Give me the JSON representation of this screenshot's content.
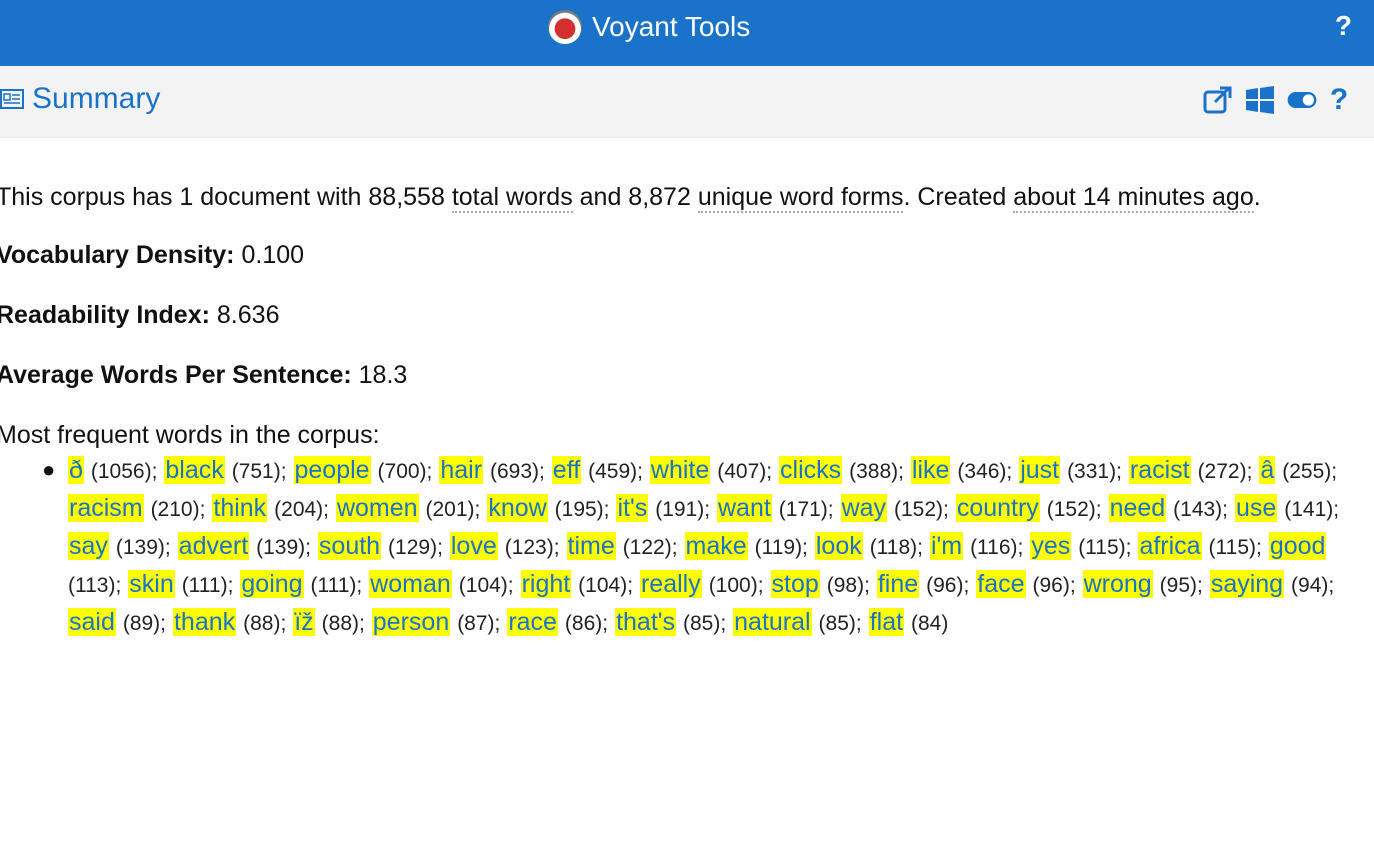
{
  "app": {
    "title": "Voyant Tools",
    "help_label": "?"
  },
  "panel": {
    "title": "Summary",
    "help_label": "?"
  },
  "summary": {
    "corpus_prefix": "This corpus has 1 document with 88,558 ",
    "total_words_link": "total words",
    "middle": " and 8,872 ",
    "unique_words_link": "unique word forms",
    "created_text": ". Created ",
    "created_link": "about 14 minutes ago",
    "period": "."
  },
  "metrics": {
    "vocab_label": "Vocabulary Density:",
    "vocab_value": "0.100",
    "readability_label": "Readability Index:",
    "readability_value": "8.636",
    "avg_label": "Average Words Per Sentence:",
    "avg_value": "18.3"
  },
  "frequent": {
    "heading": "Most frequent words in the corpus:",
    "terms": [
      {
        "term": "ð",
        "count": "(1056)"
      },
      {
        "term": "black",
        "count": "(751)"
      },
      {
        "term": "people",
        "count": "(700)"
      },
      {
        "term": "hair",
        "count": "(693)"
      },
      {
        "term": "eff",
        "count": "(459)"
      },
      {
        "term": "white",
        "count": "(407)"
      },
      {
        "term": "clicks",
        "count": "(388)"
      },
      {
        "term": "like",
        "count": "(346)"
      },
      {
        "term": "just",
        "count": "(331)"
      },
      {
        "term": "racist",
        "count": "(272)"
      },
      {
        "term": "â",
        "count": "(255)"
      },
      {
        "term": "racism",
        "count": "(210)"
      },
      {
        "term": "think",
        "count": "(204)"
      },
      {
        "term": "women",
        "count": "(201)"
      },
      {
        "term": "know",
        "count": "(195)"
      },
      {
        "term": "it's",
        "count": "(191)"
      },
      {
        "term": "want",
        "count": "(171)"
      },
      {
        "term": "way",
        "count": "(152)"
      },
      {
        "term": "country",
        "count": "(152)"
      },
      {
        "term": "need",
        "count": "(143)"
      },
      {
        "term": "use",
        "count": "(141)"
      },
      {
        "term": "say",
        "count": "(139)"
      },
      {
        "term": "advert",
        "count": "(139)"
      },
      {
        "term": "south",
        "count": "(129)"
      },
      {
        "term": "love",
        "count": "(123)"
      },
      {
        "term": "time",
        "count": "(122)"
      },
      {
        "term": "make",
        "count": "(119)"
      },
      {
        "term": "look",
        "count": "(118)"
      },
      {
        "term": "i'm",
        "count": "(116)"
      },
      {
        "term": "yes",
        "count": "(115)"
      },
      {
        "term": "africa",
        "count": "(115)"
      },
      {
        "term": "good",
        "count": "(113)"
      },
      {
        "term": "skin",
        "count": "(111)"
      },
      {
        "term": "going",
        "count": "(111)"
      },
      {
        "term": "woman",
        "count": "(104)"
      },
      {
        "term": "right",
        "count": "(104)"
      },
      {
        "term": "really",
        "count": "(100)"
      },
      {
        "term": "stop",
        "count": "(98)"
      },
      {
        "term": "fine",
        "count": "(96)"
      },
      {
        "term": "face",
        "count": "(96)"
      },
      {
        "term": "wrong",
        "count": "(95)"
      },
      {
        "term": "saying",
        "count": "(94)"
      },
      {
        "term": "said",
        "count": "(89)"
      },
      {
        "term": "thank",
        "count": "(88)"
      },
      {
        "term": "ïž",
        "count": "(88)"
      },
      {
        "term": "person",
        "count": "(87)"
      },
      {
        "term": "race",
        "count": "(86)"
      },
      {
        "term": "that's",
        "count": "(85)"
      },
      {
        "term": "natural",
        "count": "(85)"
      },
      {
        "term": "flat",
        "count": "(84)"
      }
    ]
  }
}
